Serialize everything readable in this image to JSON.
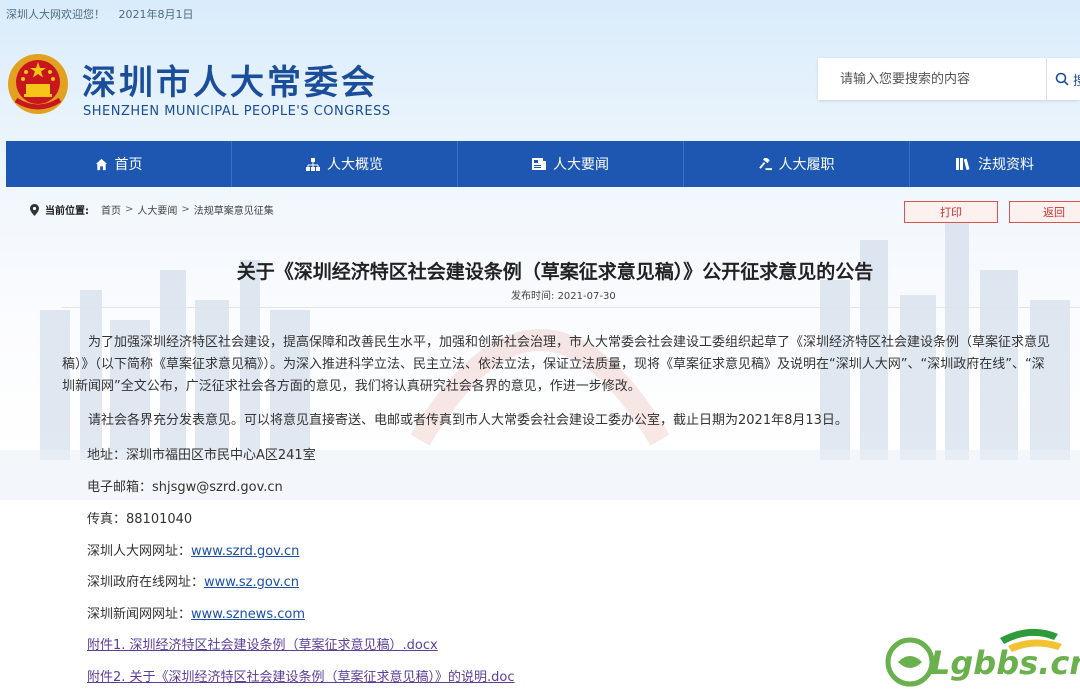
{
  "topbar": {
    "welcome": "深圳人大网欢迎您！",
    "date": "2021年8月1日"
  },
  "header": {
    "title": "深圳市人大常委会",
    "subtitle": "SHENZHEN MUNICIPAL PEOPLE'S CONGRESS",
    "search_placeholder": "请输入您要搜索的内容",
    "search_label": "搜"
  },
  "nav": [
    {
      "label": "首页",
      "icon": "home-icon"
    },
    {
      "label": "人大概览",
      "icon": "sitemap-icon"
    },
    {
      "label": "人大要闻",
      "icon": "news-icon"
    },
    {
      "label": "人大履职",
      "icon": "gavel-icon"
    },
    {
      "label": "法规资料",
      "icon": "books-icon"
    }
  ],
  "breadcrumb": {
    "label": "当前位置:",
    "items": [
      "首页",
      "人大要闻",
      "法规草案意见征集"
    ],
    "separator": ">"
  },
  "actions": {
    "print": "打印",
    "back": "返回"
  },
  "article": {
    "title": "关于《深圳经济特区社会建设条例（草案征求意见稿）》公开征求意见的公告",
    "publish_label": "发布时间:",
    "publish_date": "2021-07-30",
    "paragraphs": [
      "为了加强深圳经济特区社会建设，提高保障和改善民生水平，加强和创新社会治理，市人大常委会社会建设工委组织起草了《深圳经济特区社会建设条例（草案征求意见稿）》（以下简称《草案征求意见稿》）。为深入推进科学立法、民主立法、依法立法，保证立法质量，现将《草案征求意见稿》及说明在“深圳人大网”、“深圳政府在线”、“深圳新闻网”全文公布，广泛征求社会各方面的意见，我们将认真研究社会各界的意见，作进一步修改。",
      "请社会各界充分发表意见。可以将意见直接寄送、电邮或者传真到市人大常委会社会建设工委办公室，截止日期为2021年8月13日。"
    ],
    "address": "地址：深圳市福田区市民中心A区241室",
    "email": "电子邮箱：shjsgw@szrd.gov.cn",
    "fax": "传真：88101040",
    "links": [
      {
        "label": "深圳人大网网址：",
        "url": "www.szrd.gov.cn"
      },
      {
        "label": "深圳政府在线网址：",
        "url": "www.sz.gov.cn"
      },
      {
        "label": "深圳新闻网网址：",
        "url": "www.sznews.com"
      }
    ],
    "attachments": [
      "附件1. 深圳经济特区社会建设条例（草案征求意见稿）.docx",
      "附件2. 关于《深圳经济特区社会建设条例（草案征求意见稿）》的说明.doc"
    ]
  },
  "watermark": {
    "text": "Lgbbs.cn"
  },
  "colors": {
    "brand": "#1a4e9a",
    "nav_bg": "#1e57b1",
    "alert": "#c9302c"
  }
}
